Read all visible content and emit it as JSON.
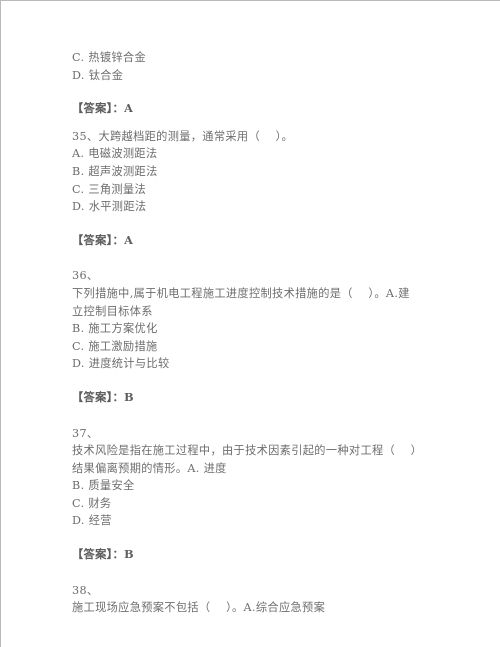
{
  "document": {
    "type": "exam-question-sheet",
    "language": "zh-CN",
    "text_color": "#6d6d6d",
    "background_color": "#ffffff",
    "border_color": "#b9b9b9"
  },
  "blocks": [
    {
      "kind": "options_tail",
      "lines": [
        "C. 热镀锌合金",
        "D. 钛合金"
      ]
    },
    {
      "kind": "answer",
      "line": "【答案】：A"
    },
    {
      "kind": "question",
      "number": "35",
      "lines": [
        "35、大跨越档距的测量，通常采用（    ）。",
        "A. 电磁波测距法",
        "B. 超声波测距法",
        "C. 三角测量法",
        "D. 水平测距法"
      ]
    },
    {
      "kind": "answer",
      "line": "【答案】：A"
    },
    {
      "kind": "question",
      "number": "36",
      "lines": [
        "36、",
        "下列措施中,属于机电工程施工进度控制技术措施的是（    ）。A.建",
        "立控制目标体系",
        "B. 施工方案优化",
        "C. 施工激励措施",
        "D. 进度统计与比较"
      ]
    },
    {
      "kind": "answer",
      "line": "【答案】：B"
    },
    {
      "kind": "question",
      "number": "37",
      "lines": [
        "37、",
        "技术风险是指在施工过程中，由于技术因素引起的一种对工程（    ）",
        "结果偏离预期的情形。A. 进度",
        "B. 质量安全",
        "C. 财务",
        "D. 经营"
      ]
    },
    {
      "kind": "answer",
      "line": "【答案】：B"
    },
    {
      "kind": "question",
      "number": "38",
      "lines": [
        "38、",
        "施工现场应急预案不包括（    ）。A.综合应急预案"
      ]
    }
  ]
}
